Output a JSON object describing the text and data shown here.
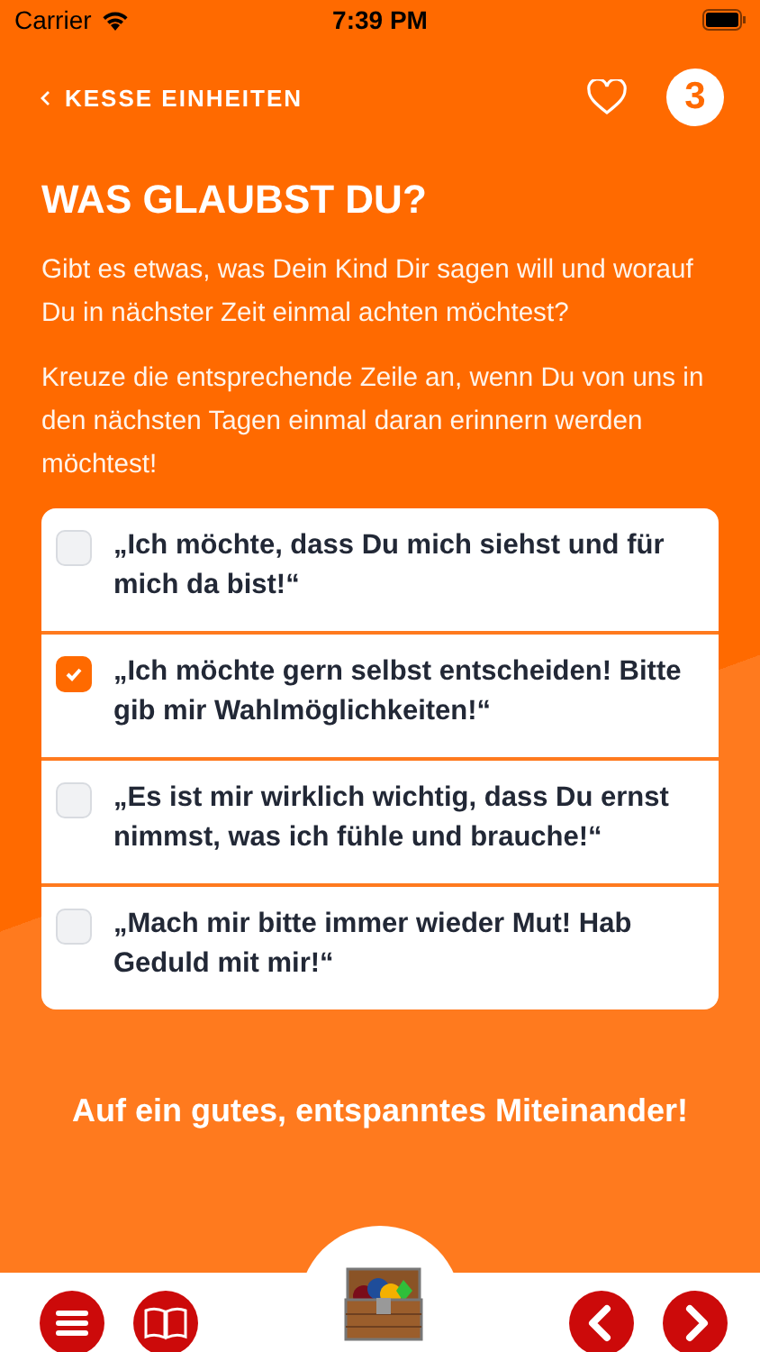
{
  "status_bar": {
    "carrier": "Carrier",
    "time": "7:39 PM"
  },
  "nav": {
    "back_label": "KESSE EINHEITEN",
    "badge": "3",
    "favorite": false
  },
  "title": "WAS GLAUBST DU?",
  "paragraphs": [
    "Gibt es etwas, was Dein Kind Dir sagen will und worauf Du in nächster Zeit einmal achten möchtest?",
    "Kreuze die entsprechende Zeile an, wenn Du von uns in den nächsten Tagen einmal daran erinnern werden möchtest!"
  ],
  "options": [
    {
      "text": "„Ich möchte, dass Du mich siehst und für mich da bist!“",
      "checked": false
    },
    {
      "text": "„Ich möchte gern selbst entscheiden! Bitte gib mir Wahlmöglichkeiten!“",
      "checked": true
    },
    {
      "text": "„Es ist mir wirklich wichtig, dass Du ernst nimmst, was ich fühle und brauche!“",
      "checked": false
    },
    {
      "text": "„Mach mir bitte immer wieder Mut! Hab Geduld mit mir!“",
      "checked": false
    }
  ],
  "closing": "Auf ein gutes, entspanntes Miteinander!"
}
